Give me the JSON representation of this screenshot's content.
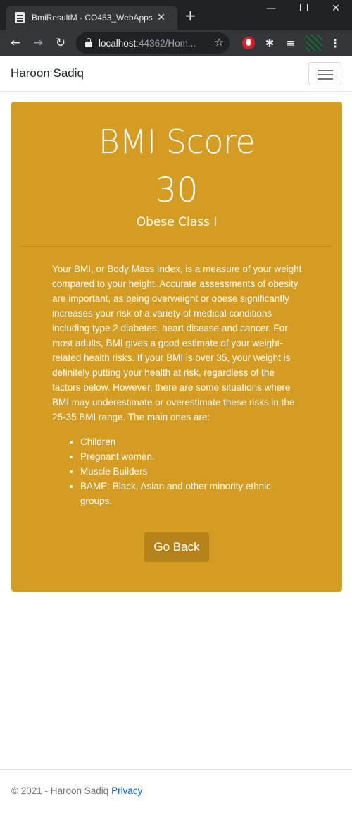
{
  "browser": {
    "tab_title": "BmiResultM - CO453_WebApps",
    "tab_close": "✕",
    "new_tab": "+",
    "url_host": "localhost",
    "url_rest": ":44362/Hom...",
    "icons": [
      "page-favicon",
      "back-arrow",
      "forward-arrow",
      "reload",
      "lock",
      "star",
      "adblock-extension",
      "extensions-puzzle",
      "media-control",
      "profile-avatar",
      "menu-dots"
    ]
  },
  "navbar": {
    "brand": "Haroon Sadiq"
  },
  "result": {
    "heading": "BMI Score",
    "score": "30",
    "classification": "Obese Class I",
    "description": "Your BMI, or Body Mass Index, is a measure of your weight compared to your height. Accurate assessments of obesity are important, as being overweight or obese significantly increases your risk of a variety of medical conditions including type 2 diabetes, heart disease and cancer. For most adults, BMI gives a good estimate of your weight-related health risks. If your BMI is over 35, your weight is definitely putting your health at risk, regardless of the factors below. However, there are some situations where BMI may underestimate or overestimate these risks in the 25-35 BMI range. The main ones are:",
    "factors": [
      "Children",
      "Pregnant women.",
      "Muscle Builders",
      "BAME: Black, Asian and other minority ethnic groups."
    ],
    "back_label": "Go Back",
    "bg_color": "#d49c23",
    "button_color": "#b6831b"
  },
  "footer": {
    "copyright": "© 2021 - Haroon Sadiq",
    "privacy_label": "Privacy"
  }
}
